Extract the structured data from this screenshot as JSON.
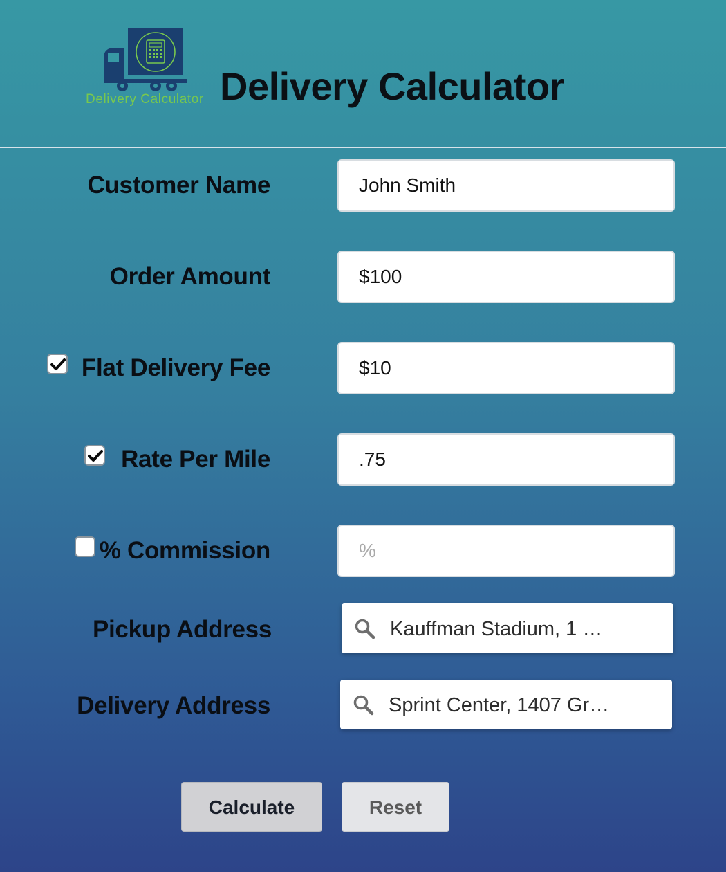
{
  "header": {
    "title": "Delivery Calculator",
    "logo_caption": "Delivery Calculator",
    "logo_icon": "delivery-truck-calculator-logo"
  },
  "form": {
    "customer_name": {
      "label": "Customer Name",
      "value": "John Smith",
      "placeholder": ""
    },
    "order_amount": {
      "label": "Order Amount",
      "value": "$100",
      "placeholder": ""
    },
    "flat_delivery_fee": {
      "label": "Flat Delivery Fee",
      "checked": true,
      "value": "$10",
      "placeholder": ""
    },
    "rate_per_mile": {
      "label": "Rate Per Mile",
      "checked": true,
      "value": ".75",
      "placeholder": ""
    },
    "commission": {
      "label": "% Commission",
      "checked": false,
      "value": "",
      "placeholder": "%"
    },
    "pickup_address": {
      "label": "Pickup Address",
      "value": "Kauffman Stadium, 1 …",
      "icon": "search-icon"
    },
    "delivery_address": {
      "label": "Delivery Address",
      "value": "Sprint Center, 1407 Gr…",
      "icon": "search-icon"
    }
  },
  "buttons": {
    "calculate": "Calculate",
    "reset": "Reset"
  },
  "colors": {
    "background_top": "#3798a4",
    "background_bottom": "#2d4489",
    "logo_navy": "#1a3f6f",
    "logo_green": "#78c84e"
  }
}
